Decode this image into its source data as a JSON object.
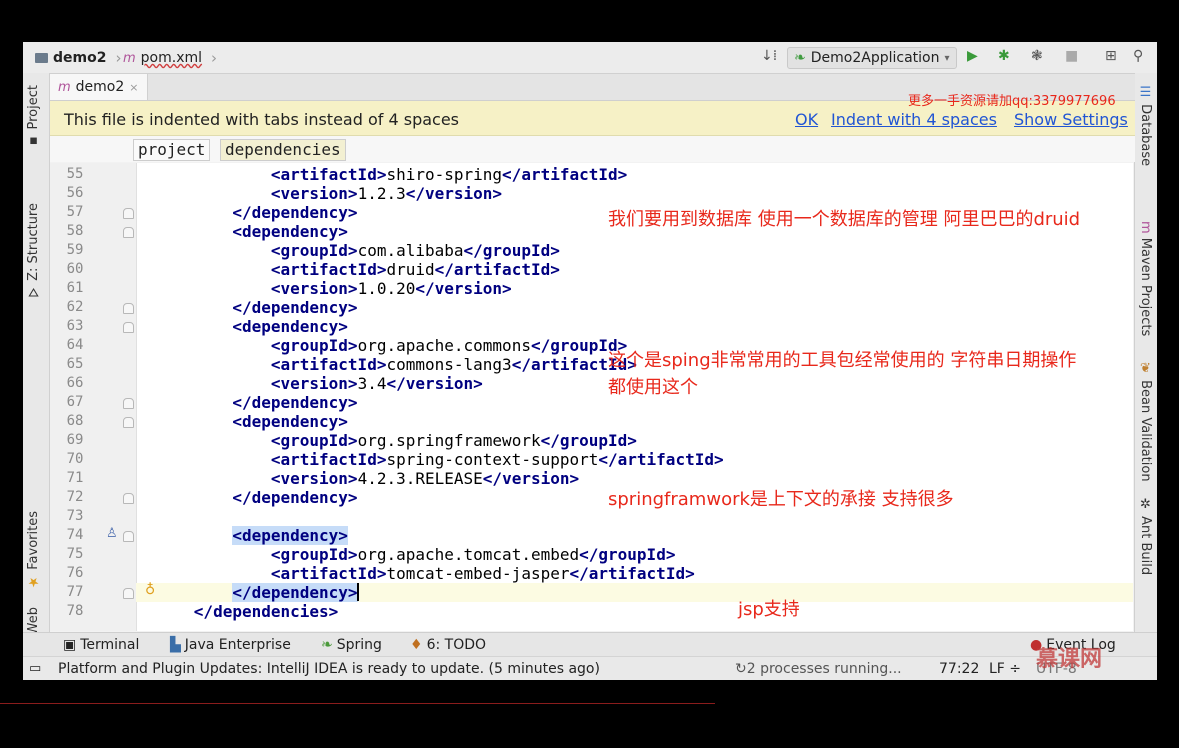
{
  "breadcrumb": {
    "project": "demo2",
    "file": "pom.xml"
  },
  "toolbar": {
    "run_config": "Demo2Application"
  },
  "left_tabs": {
    "project": "Project",
    "structure": "Z: Structure",
    "favorites": "Favorites",
    "web": "Web"
  },
  "right_tabs": {
    "database": "Database",
    "maven": "Maven Projects",
    "bean_validation": "Bean Validation",
    "ant": "Ant Build"
  },
  "tab": {
    "label": "demo2"
  },
  "banner": {
    "message": "This file is indented with tabs instead of 4 spaces",
    "ok": "OK",
    "indent": "Indent with 4 spaces",
    "settings": "Show Settings"
  },
  "xml_crumbs": [
    "project",
    "dependencies"
  ],
  "lines": [
    {
      "n": "55",
      "indent": "        ",
      "tag": "artifactId",
      "text": "shiro-spring"
    },
    {
      "n": "56",
      "indent": "        ",
      "tag": "version",
      "text": "1.2.3"
    },
    {
      "n": "57",
      "indent": "    ",
      "close": "dependency"
    },
    {
      "n": "58",
      "indent": "    ",
      "open": "dependency"
    },
    {
      "n": "59",
      "indent": "        ",
      "tag": "groupId",
      "text": "com.alibaba"
    },
    {
      "n": "60",
      "indent": "        ",
      "tag": "artifactId",
      "text": "druid"
    },
    {
      "n": "61",
      "indent": "        ",
      "tag": "version",
      "text": "1.0.20"
    },
    {
      "n": "62",
      "indent": "    ",
      "close": "dependency"
    },
    {
      "n": "63",
      "indent": "    ",
      "open": "dependency"
    },
    {
      "n": "64",
      "indent": "        ",
      "tag": "groupId",
      "text": "org.apache.commons"
    },
    {
      "n": "65",
      "indent": "        ",
      "tag": "artifactId",
      "text": "commons-lang3"
    },
    {
      "n": "66",
      "indent": "        ",
      "tag": "version",
      "text": "3.4"
    },
    {
      "n": "67",
      "indent": "    ",
      "close": "dependency"
    },
    {
      "n": "68",
      "indent": "    ",
      "open": "dependency"
    },
    {
      "n": "69",
      "indent": "        ",
      "tag": "groupId",
      "text": "org.springframework"
    },
    {
      "n": "70",
      "indent": "        ",
      "tag": "artifactId",
      "text": "spring-context-support"
    },
    {
      "n": "71",
      "indent": "        ",
      "tag": "version",
      "text": "4.2.3.RELEASE"
    },
    {
      "n": "72",
      "indent": "    ",
      "close": "dependency"
    },
    {
      "n": "73",
      "indent": "",
      "blank": true
    },
    {
      "n": "74",
      "indent": "    ",
      "open": "dependency",
      "highlight": true
    },
    {
      "n": "75",
      "indent": "        ",
      "tag": "groupId",
      "text": "org.apache.tomcat.embed"
    },
    {
      "n": "76",
      "indent": "        ",
      "tag": "artifactId",
      "text": "tomcat-embed-jasper"
    },
    {
      "n": "77",
      "indent": "    ",
      "close": "dependency",
      "highlight": true,
      "current": true
    },
    {
      "n": "78",
      "indent": "",
      "close": "dependencies"
    }
  ],
  "annotations": {
    "druid": "我们要用到数据库  使用一个数据库的管理  阿里巴巴的druid",
    "lang3_a": "这个是sping非常常用的工具包经常使用的   字符串日期操作",
    "lang3_b": "都使用这个",
    "spring": "springframwork是上下文的承接   支持很多",
    "jsp": "jsp支持",
    "qq": "更多一手资源请加qq:3379977696"
  },
  "tool_windows": {
    "terminal": "Terminal",
    "java_ee": "Java Enterprise",
    "spring": "Spring",
    "todo": "6: TODO",
    "event_log": "Event Log"
  },
  "status": {
    "message": "Platform and Plugin Updates: IntelliJ IDEA is ready to update. (5 minutes ago)",
    "processes": "2 processes running...",
    "position": "77:22",
    "line_sep": "LF",
    "encoding": "UTF-8"
  },
  "watermark": "慕课网",
  "colors": {
    "annotation": "#e8281b",
    "tag": "#000080",
    "link": "#2155d4",
    "banner_bg": "#f6f1c6"
  }
}
